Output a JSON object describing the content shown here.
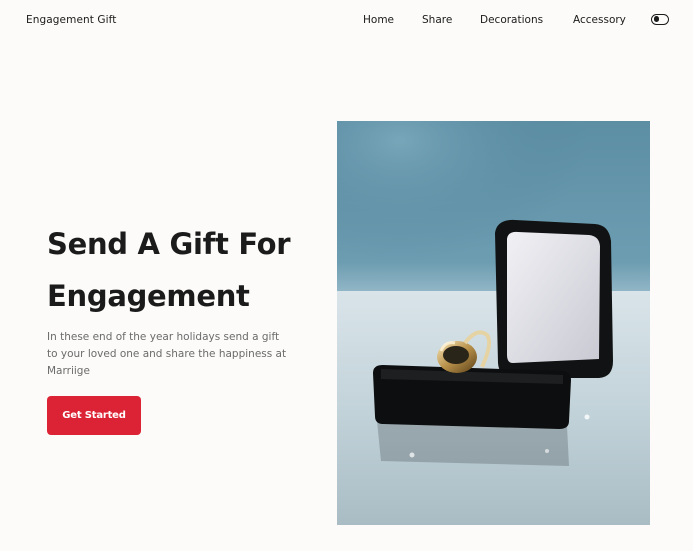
{
  "header": {
    "logo": "Engagement Gift",
    "nav": [
      {
        "label": "Home"
      },
      {
        "label": "Share"
      },
      {
        "label": "Decorations"
      },
      {
        "label": "Accessory"
      }
    ],
    "theme_toggle_icon": "toggle-switch-icon"
  },
  "hero": {
    "title_line1": "Send A Gift For",
    "title_line2": "Engagement",
    "description": "In these end of the year holidays send a gift to your loved one and share the happiness at Marriige",
    "cta_label": "Get Started",
    "image_subject": "ring-box-photo"
  },
  "colors": {
    "background": "#fcfbf9",
    "text": "#1b1b1b",
    "muted_text": "#6b6b6b",
    "accent": "#dc2335"
  }
}
